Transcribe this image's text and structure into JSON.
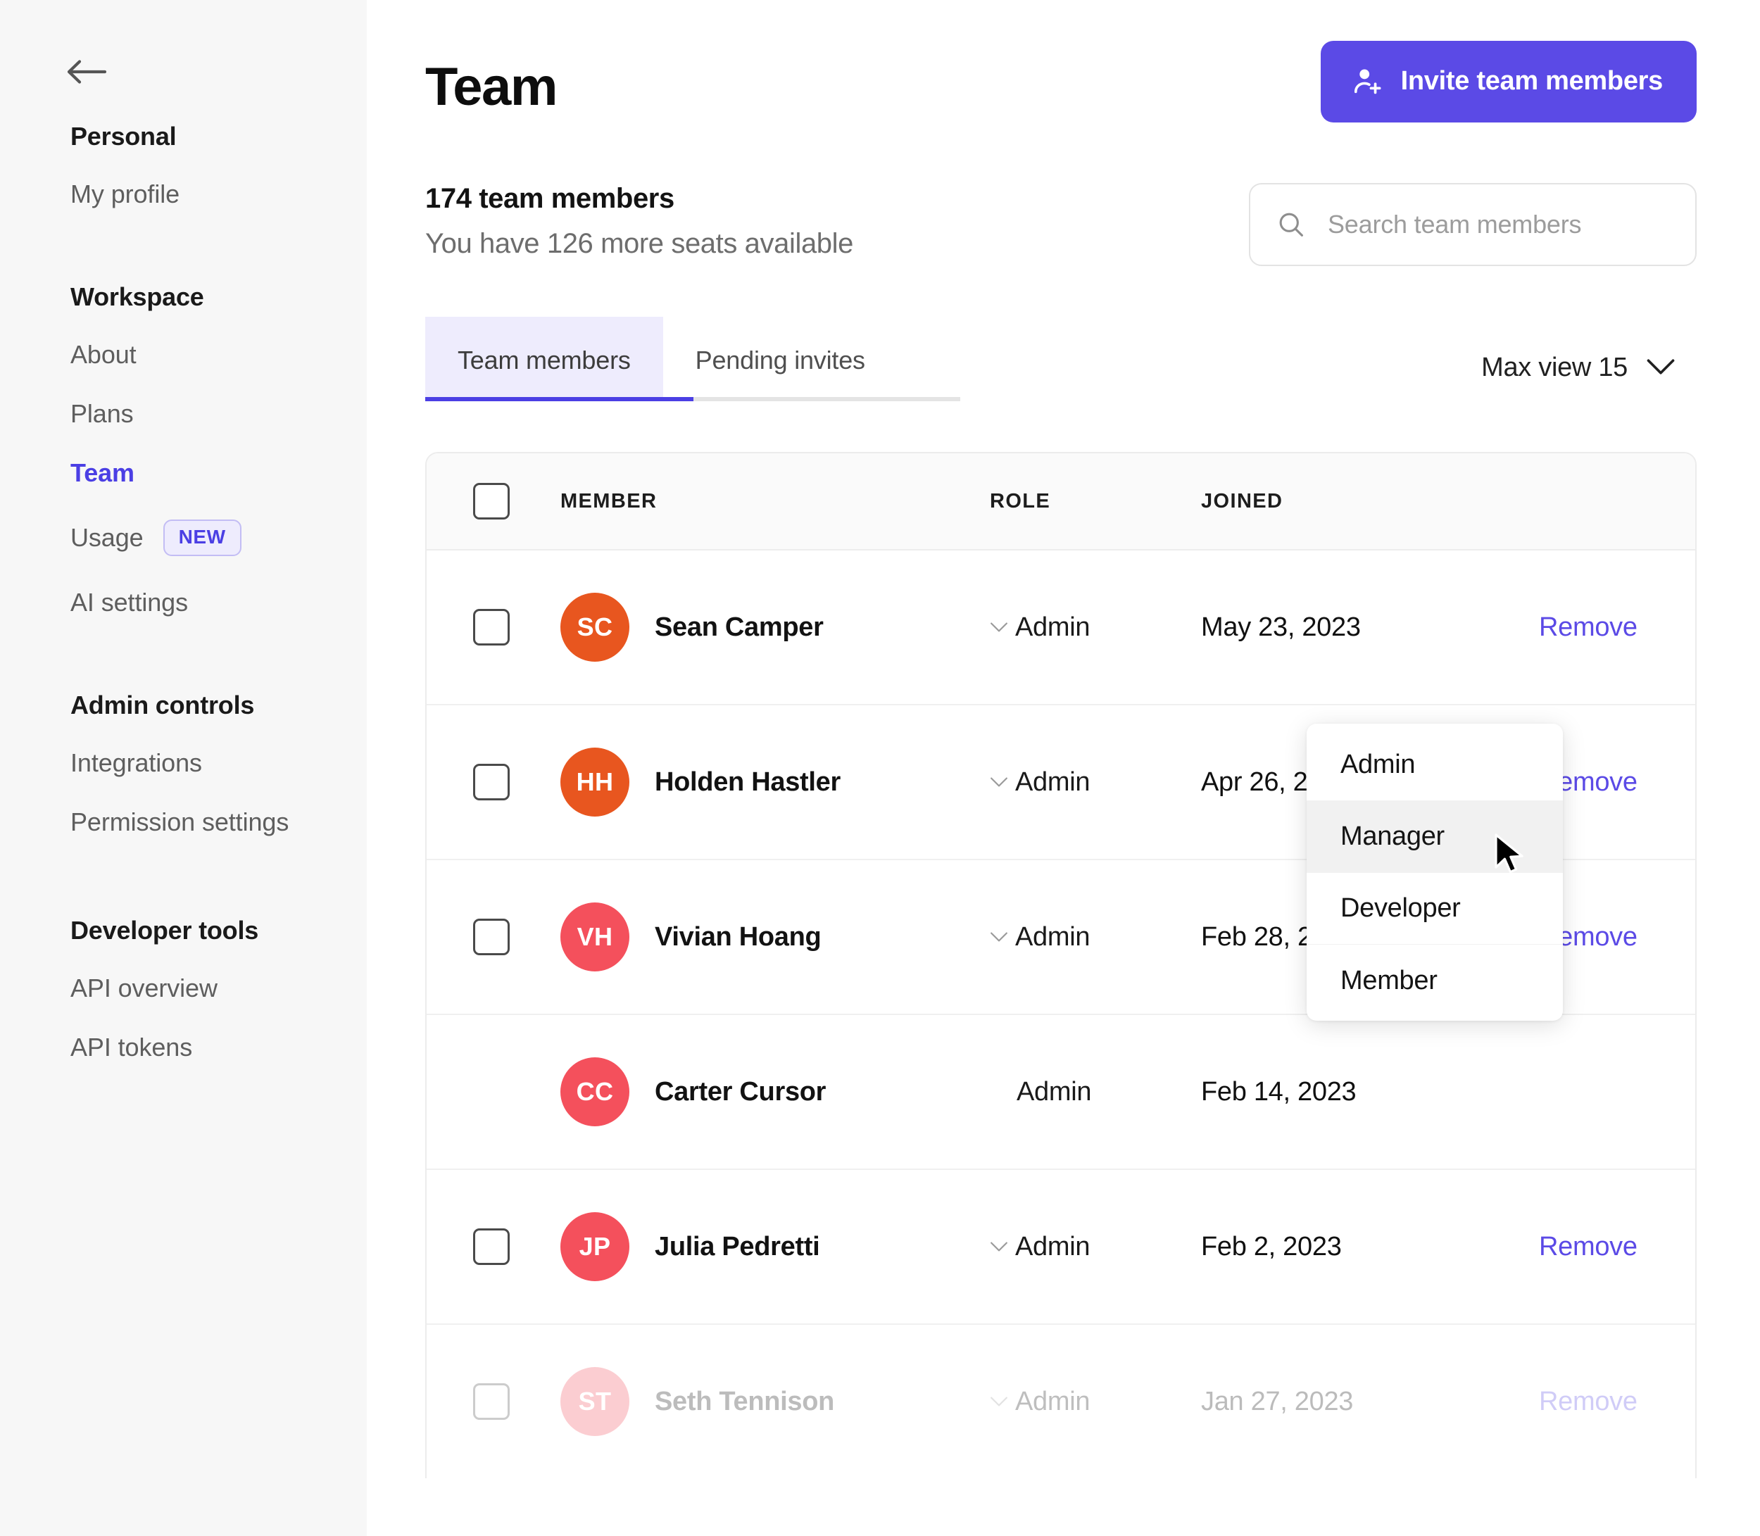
{
  "sidebar": {
    "back_icon": "arrow-left-icon",
    "groups": [
      {
        "heading": "Personal",
        "items": [
          {
            "label": "My profile",
            "active": false
          }
        ]
      },
      {
        "heading": "Workspace",
        "items": [
          {
            "label": "About",
            "active": false
          },
          {
            "label": "Plans",
            "active": false
          },
          {
            "label": "Team",
            "active": true
          },
          {
            "label": "Usage",
            "active": false,
            "badge": "NEW"
          },
          {
            "label": "AI settings",
            "active": false
          }
        ]
      },
      {
        "heading": "Admin controls",
        "items": [
          {
            "label": "Integrations",
            "active": false
          },
          {
            "label": "Permission settings",
            "active": false
          }
        ]
      },
      {
        "heading": "Developer tools",
        "items": [
          {
            "label": "API overview",
            "active": false
          },
          {
            "label": "API tokens",
            "active": false
          }
        ]
      }
    ]
  },
  "header": {
    "title": "Team",
    "invite_button_label": "Invite team members",
    "invite_button_icon": "user-plus-icon",
    "invite_button_color": "#5b4ae6"
  },
  "summary": {
    "member_count_text": "174 team members",
    "seats_text": "You have 126 more seats available"
  },
  "search": {
    "placeholder": "Search team members",
    "value": "",
    "icon": "search-icon"
  },
  "tabs": {
    "items": [
      {
        "label": "Team members",
        "active": true
      },
      {
        "label": "Pending invites",
        "active": false
      }
    ],
    "active_color": "#4b3fe4"
  },
  "view_control": {
    "label": "Max view 15",
    "icon": "chevron-down-icon"
  },
  "table": {
    "columns": [
      "MEMBER",
      "ROLE",
      "JOINED"
    ],
    "select_all_checkbox": false,
    "rows": [
      {
        "initials": "SC",
        "name": "Sean Camper",
        "avatar_color": "#e8561f",
        "role": "Admin",
        "joined": "May 23, 2023",
        "action": "Remove",
        "has_checkbox": true,
        "has_role_chevron": true,
        "faded": false
      },
      {
        "initials": "HH",
        "name": "Holden Hastler",
        "avatar_color": "#e8561f",
        "role": "Admin",
        "joined": "Apr 26, 2023",
        "action": "Remove",
        "has_checkbox": true,
        "has_role_chevron": true,
        "faded": false
      },
      {
        "initials": "VH",
        "name": "Vivian Hoang",
        "avatar_color": "#f4505c",
        "role": "Admin",
        "joined": "Feb 28, 2023",
        "action": "Remove",
        "has_checkbox": true,
        "has_role_chevron": true,
        "faded": false
      },
      {
        "initials": "CC",
        "name": "Carter Cursor",
        "avatar_color": "#f4505c",
        "role": "Admin",
        "joined": "Feb 14, 2023",
        "action": "",
        "has_checkbox": false,
        "has_role_chevron": false,
        "faded": false
      },
      {
        "initials": "JP",
        "name": "Julia Pedretti",
        "avatar_color": "#f4505c",
        "role": "Admin",
        "joined": "Feb 2, 2023",
        "action": "Remove",
        "has_checkbox": true,
        "has_role_chevron": true,
        "faded": false
      },
      {
        "initials": "ST",
        "name": "Seth Tennison",
        "avatar_color": "#f4505c",
        "role": "Admin",
        "joined": "Jan 27, 2023",
        "action": "Remove",
        "has_checkbox": true,
        "has_role_chevron": true,
        "faded": true
      }
    ]
  },
  "role_dropdown": {
    "open": true,
    "for_row": "Sean Camper",
    "options": [
      {
        "label": "Admin",
        "hovered": false
      },
      {
        "label": "Manager",
        "hovered": true
      },
      {
        "label": "Developer",
        "hovered": false
      },
      {
        "label": "Member",
        "hovered": false
      }
    ]
  }
}
